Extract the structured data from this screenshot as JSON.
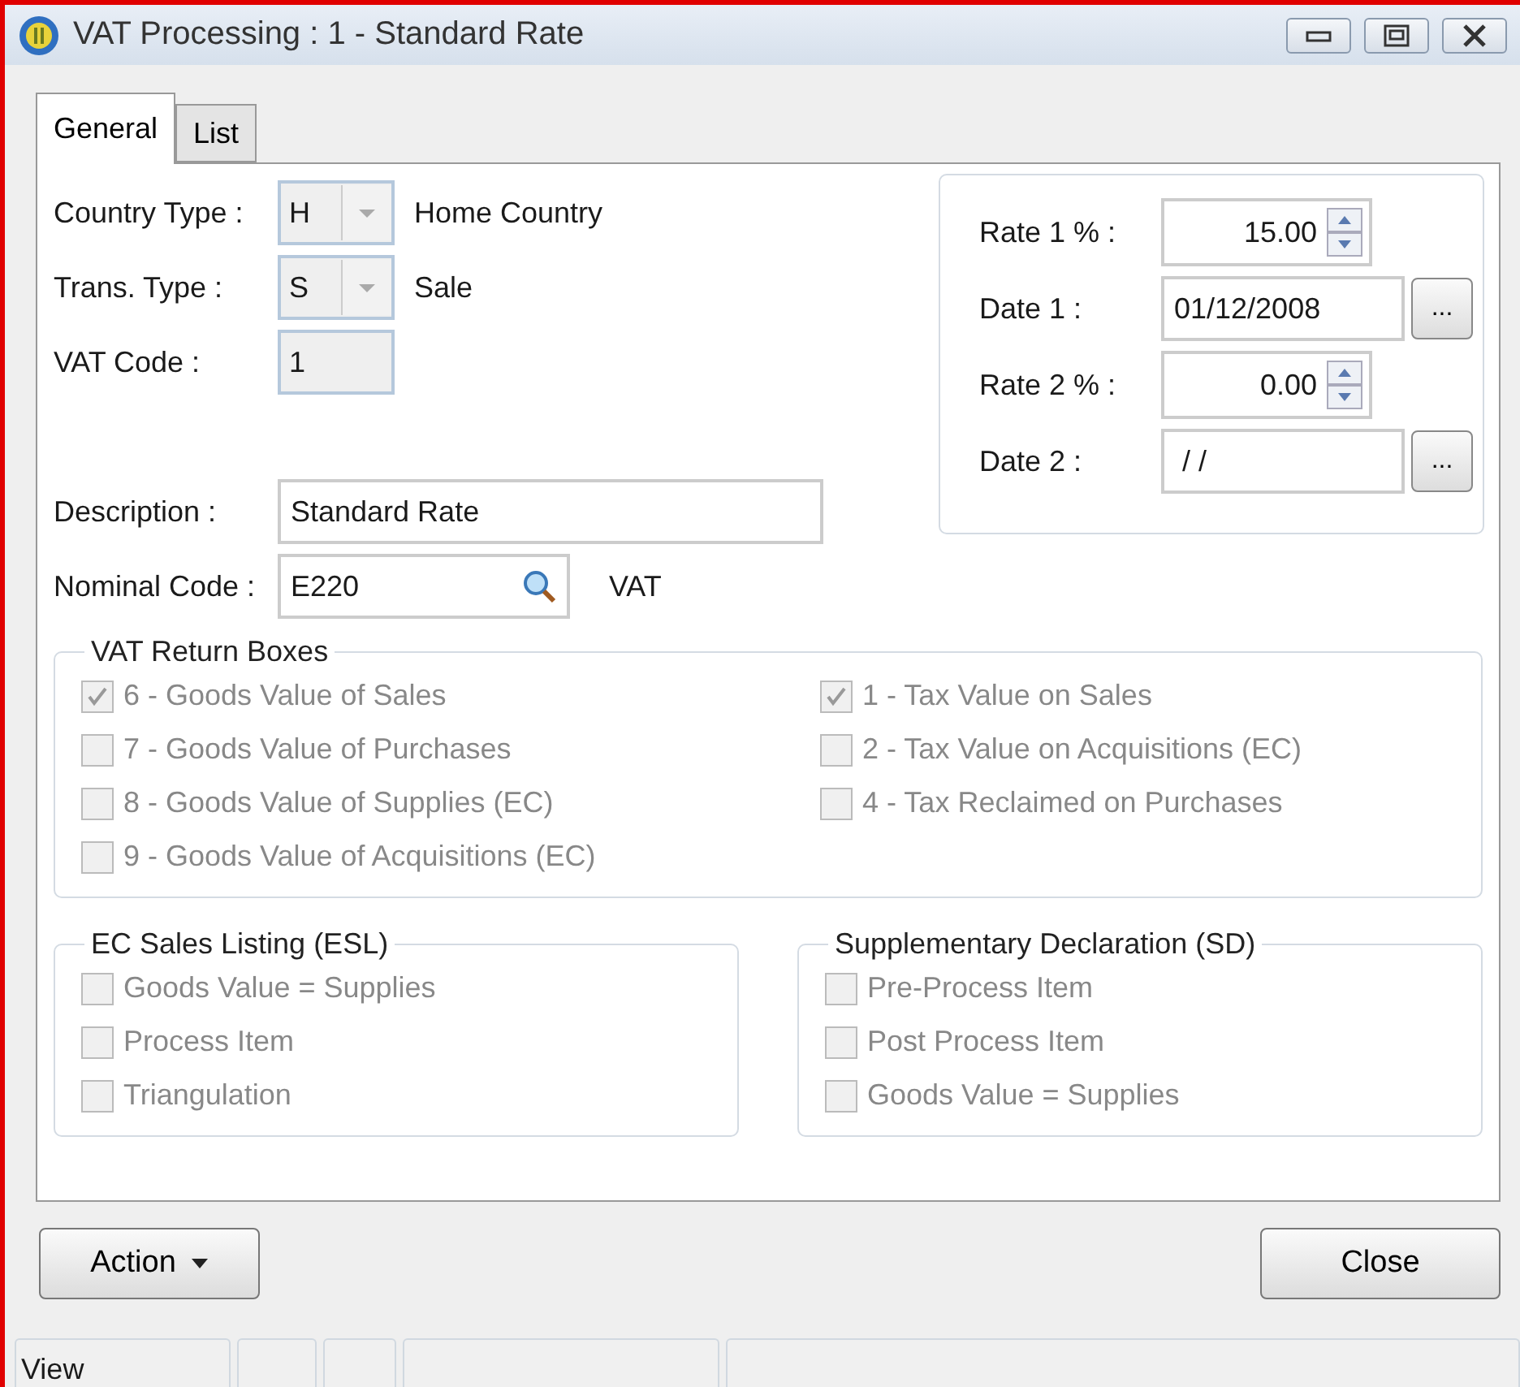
{
  "window": {
    "title": "VAT Processing : 1 - Standard Rate"
  },
  "tabs": [
    {
      "label": "General",
      "selected": true
    },
    {
      "label": "List",
      "selected": false
    }
  ],
  "fields": {
    "country_type": {
      "label": "Country Type :",
      "value": "H",
      "caption": "Home Country"
    },
    "trans_type": {
      "label": "Trans. Type :",
      "value": "S",
      "caption": "Sale"
    },
    "vat_code": {
      "label": "VAT Code :",
      "value": "1"
    },
    "description": {
      "label": "Description :",
      "value": "Standard Rate"
    },
    "nominal_code": {
      "label": "Nominal Code :",
      "value": "E220",
      "caption": "VAT"
    }
  },
  "rates": [
    {
      "kind": "spin",
      "label": "Rate 1 % :",
      "value": "15.00"
    },
    {
      "kind": "date",
      "label": "Date 1 :",
      "value": "01/12/2008",
      "button": "..."
    },
    {
      "kind": "spin",
      "label": "Rate 2 % :",
      "value": "0.00"
    },
    {
      "kind": "date",
      "label": "Date 2 :",
      "value": " / /",
      "button": "..."
    }
  ],
  "vat_return_boxes": {
    "title": "VAT Return Boxes",
    "columns": [
      [
        {
          "label": "6 - Goods Value of Sales",
          "checked": true,
          "disabled": true
        },
        {
          "label": "7 - Goods Value of Purchases",
          "checked": false,
          "disabled": true
        },
        {
          "label": "8 - Goods Value of Supplies (EC)",
          "checked": false,
          "disabled": true
        },
        {
          "label": "9 - Goods Value of Acquisitions (EC)",
          "checked": false,
          "disabled": true
        }
      ],
      [
        {
          "label": "1 - Tax Value on Sales",
          "checked": true,
          "disabled": true
        },
        {
          "label": "2 - Tax Value on Acquisitions (EC)",
          "checked": false,
          "disabled": true
        },
        {
          "label": "4 - Tax Reclaimed on Purchases",
          "checked": false,
          "disabled": true
        }
      ]
    ]
  },
  "groups": [
    {
      "title": "EC Sales Listing (ESL)",
      "items": [
        {
          "label": "Goods Value = Supplies",
          "checked": false,
          "disabled": true
        },
        {
          "label": "Process Item",
          "checked": false,
          "disabled": true
        },
        {
          "label": "Triangulation",
          "checked": false,
          "disabled": true
        }
      ]
    },
    {
      "title": "Supplementary Declaration (SD)",
      "items": [
        {
          "label": "Pre-Process Item",
          "checked": false,
          "disabled": true
        },
        {
          "label": "Post Process Item",
          "checked": false,
          "disabled": true
        },
        {
          "label": "Goods Value = Supplies",
          "checked": false,
          "disabled": true
        }
      ]
    }
  ],
  "buttons": {
    "action": "Action",
    "close": "Close"
  },
  "status_bar": [
    "View"
  ]
}
